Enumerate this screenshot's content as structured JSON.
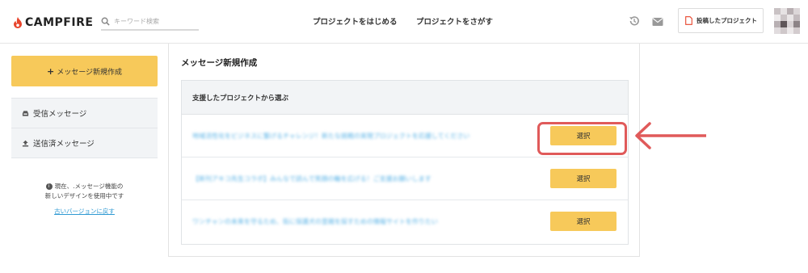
{
  "header": {
    "logo_text": "CAMPFIRE",
    "search_placeholder": "キーワード検索",
    "nav_start": "プロジェクトをはじめる",
    "nav_find": "プロジェクトをさがす",
    "posted_projects": "投稿したプロジェクト"
  },
  "sidebar": {
    "new_message": "メッセージ新規作成",
    "inbox": "受信メッセージ",
    "sent": "送信済メッセージ",
    "notice_line1": "現在、.メッセージ機能の",
    "notice_line2": "新しいデザインを使用中です",
    "old_version_link": "古いバージョンに戻す"
  },
  "main": {
    "title": "メッセージ新規作成",
    "list_header": "支援したプロジェクトから選ぶ",
    "select_label": "選択",
    "projects": [
      {
        "name": "地域活性化をビジネスに繋げるチャレンジ！新たな挑戦の実現プロジェクトを応援してください"
      },
      {
        "name": "【新刊アキコ先生コラボ】みんなで読んで笑顔の輪を広げる！ご支援お願いします"
      },
      {
        "name": "ワンチャンの未来を守るため、街に保護犬の里親を探すための情報サイトを作りたい"
      }
    ]
  },
  "colors": {
    "accent_yellow": "#f7c95a",
    "brand_red": "#e8452c",
    "highlight_red": "#e05a5a",
    "link_blue": "#2f9ad3"
  }
}
